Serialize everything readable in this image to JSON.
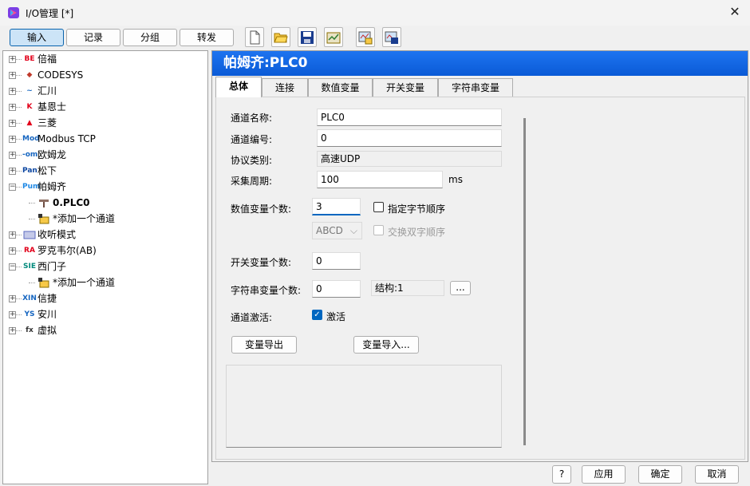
{
  "window": {
    "title": "I/O管理 [*]"
  },
  "top_tabs": [
    "输入",
    "记录",
    "分组",
    "转发"
  ],
  "toolbar": {
    "icons": [
      "new-file-icon",
      "open-folder-icon",
      "save-icon",
      "export-icon",
      "import-icon",
      "settings-icon"
    ]
  },
  "tree": {
    "items": [
      {
        "label": "倍福",
        "icon": "BE",
        "color": "#e2001a"
      },
      {
        "label": "CODESYS",
        "icon": "◆",
        "color": "#c0392b"
      },
      {
        "label": "汇川",
        "icon": "~",
        "color": "#1565c0"
      },
      {
        "label": "基恩士",
        "icon": "K",
        "color": "#e2001a"
      },
      {
        "label": "三菱",
        "icon": "▲",
        "color": "#e2001a"
      },
      {
        "label": "Modbus TCP",
        "icon": "Mod",
        "color": "#1565c0"
      },
      {
        "label": "欧姆龙",
        "icon": "-om",
        "color": "#1565c0"
      },
      {
        "label": "松下",
        "icon": "Pan",
        "color": "#0d47a1"
      },
      {
        "label": "帕姆齐",
        "icon": "Pum",
        "color": "#1e88e5"
      },
      {
        "label": "0.PLC0",
        "icon": "plc",
        "color": "#6d4c41"
      },
      {
        "label": "*添加一个通道",
        "icon": "add",
        "color": "#333"
      },
      {
        "label": "收听模式",
        "icon": "lis",
        "color": "#5c6bc0"
      },
      {
        "label": "罗克韦尔(AB)",
        "icon": "RA",
        "color": "#e2001a"
      },
      {
        "label": "西门子",
        "icon": "SIE",
        "color": "#00897b"
      },
      {
        "label": "*添加一个通道",
        "icon": "add",
        "color": "#333"
      },
      {
        "label": "信捷",
        "icon": "XIN",
        "color": "#1565c0"
      },
      {
        "label": "安川",
        "icon": "YS",
        "color": "#1565c0"
      },
      {
        "label": "虚拟",
        "icon": "fx",
        "color": "#333"
      }
    ]
  },
  "panel": {
    "header": "帕姆齐:PLC0",
    "tabs": [
      "总体",
      "连接",
      "数值变量",
      "开关变量",
      "字符串变量"
    ],
    "form": {
      "name_label": "通道名称:",
      "name_value": "PLC0",
      "number_label": "通道编号:",
      "number_value": "0",
      "protocol_label": "协议类别:",
      "protocol_value": "高速UDP",
      "period_label": "采集周期:",
      "period_value": "100",
      "period_unit": "ms",
      "numvar_label": "数值变量个数:",
      "numvar_value": "3",
      "byte_order_label": "指定字节顺序",
      "byte_order_select": "ABCD",
      "swap_label": "交换双字顺序",
      "switchvar_label": "开关变量个数:",
      "switchvar_value": "0",
      "strvar_label": "字符串变量个数:",
      "strvar_value": "0",
      "struct_value": "结构:1",
      "dots_label": "...",
      "activate_label": "通道激活:",
      "activate_check": "激活",
      "export_button": "变量导出",
      "import_button": "变量导入..."
    }
  },
  "bottom": {
    "help": "?",
    "apply": "应用",
    "ok": "确定",
    "cancel": "取消"
  }
}
